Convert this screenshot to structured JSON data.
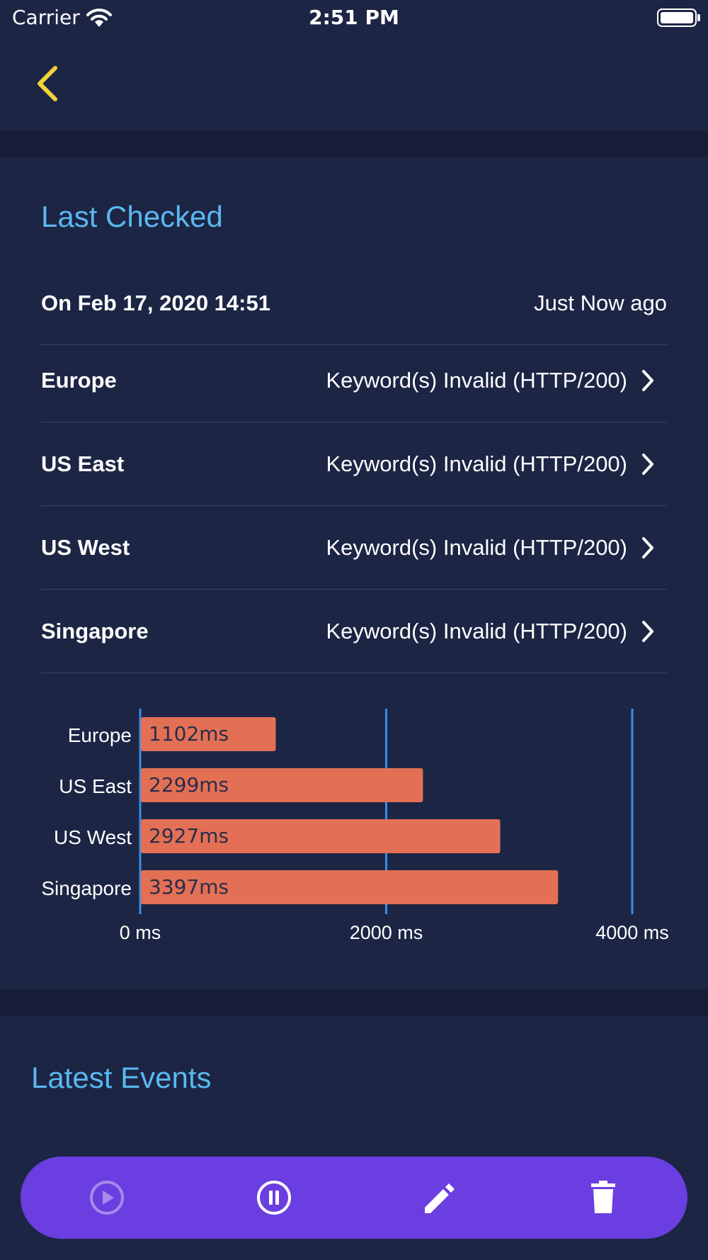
{
  "status_bar": {
    "carrier": "Carrier",
    "time": "2:51 PM"
  },
  "nav": {
    "back_icon": "chevron-left-icon",
    "accent_color": "#f2d13a"
  },
  "last_checked": {
    "title": "Last Checked",
    "date_label": "On Feb 17, 2020 14:51",
    "relative_time": "Just Now ago",
    "regions": [
      {
        "name": "Europe",
        "status": "Keyword(s) Invalid (HTTP/200)"
      },
      {
        "name": "US East",
        "status": "Keyword(s) Invalid (HTTP/200)"
      },
      {
        "name": "US West",
        "status": "Keyword(s) Invalid (HTTP/200)"
      },
      {
        "name": "Singapore",
        "status": "Keyword(s) Invalid (HTTP/200)"
      }
    ]
  },
  "chart_data": {
    "type": "bar",
    "orientation": "horizontal",
    "categories": [
      "Europe",
      "US East",
      "US West",
      "Singapore"
    ],
    "values": [
      1102,
      2299,
      2927,
      3397
    ],
    "value_labels": [
      "1102ms",
      "2299ms",
      "2927ms",
      "3397ms"
    ],
    "xlim": [
      0,
      4000
    ],
    "x_ticks": [
      0,
      2000,
      4000
    ],
    "x_tick_labels": [
      "0 ms",
      "2000 ms",
      "4000 ms"
    ],
    "grid": true,
    "bar_color": "#e37055",
    "grid_color": "#3a8ee6"
  },
  "latest_events": {
    "title": "Latest Events"
  },
  "toolbar": {
    "background": "#6a3ee0",
    "buttons": [
      {
        "icon": "play-circle-icon",
        "enabled": false
      },
      {
        "icon": "pause-circle-icon",
        "enabled": true
      },
      {
        "icon": "pencil-icon",
        "enabled": true
      },
      {
        "icon": "trash-icon",
        "enabled": true
      }
    ]
  }
}
